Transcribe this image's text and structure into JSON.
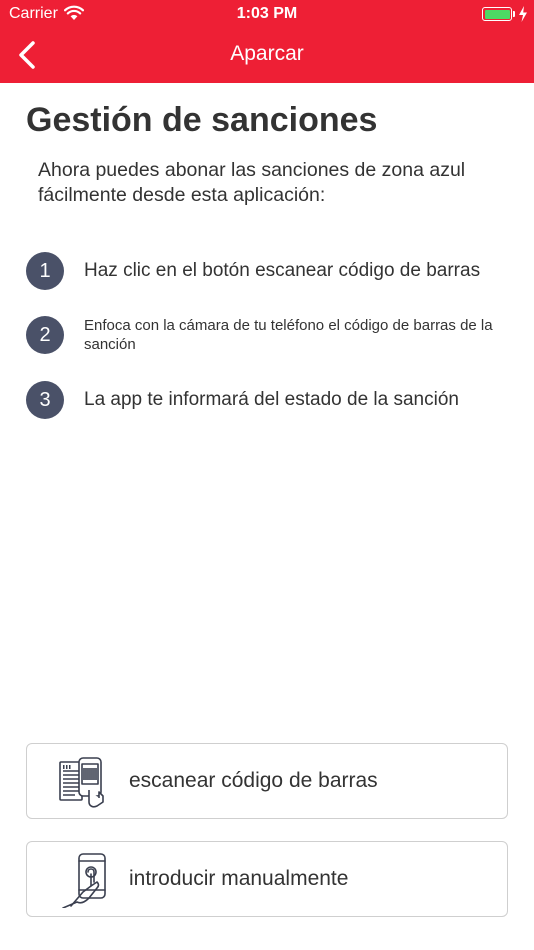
{
  "status_bar": {
    "carrier": "Carrier",
    "time": "1:03 PM"
  },
  "nav": {
    "title": "Aparcar",
    "back_icon": "chevron-left-icon"
  },
  "page": {
    "title": "Gestión de sanciones",
    "intro": "Ahora puedes abonar las sanciones de zona azul fácilmente desde esta aplicación:"
  },
  "steps": [
    {
      "number": "1",
      "text": "Haz clic en el botón escanear código de barras"
    },
    {
      "number": "2",
      "text": "Enfoca con la cámara de tu teléfono el código de barras de la sanción"
    },
    {
      "number": "3",
      "text": "La app te informará del estado de la sanción"
    }
  ],
  "actions": {
    "scan": {
      "label": "escanear código de barras",
      "icon": "barcode-scan-icon"
    },
    "manual": {
      "label": "introducir manualmente",
      "icon": "phone-touch-icon"
    }
  },
  "colors": {
    "header": "#ee1f35",
    "step_circle": "#4a5168",
    "battery": "#4cd964",
    "text": "#333333"
  }
}
